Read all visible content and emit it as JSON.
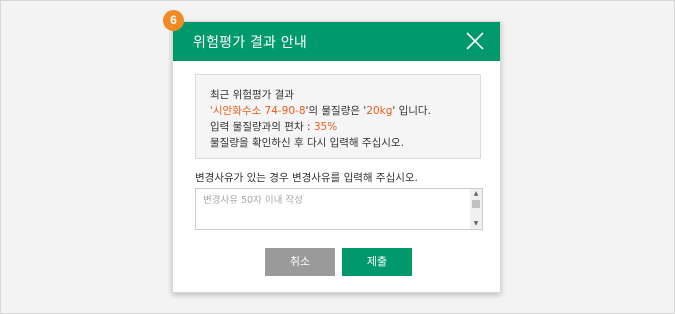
{
  "badge": {
    "number": "6",
    "color": "#f08a24"
  },
  "dialog": {
    "title": "위험평가 결과 안내",
    "close_icon": "close-x-icon",
    "header_color": "#00996b"
  },
  "info": {
    "line1": "최근 위험평가 결과",
    "line2_quote_open": "'",
    "line2_material": "시안화수소 74-90-8",
    "line2_mid": "'의 물질량은 '",
    "line2_amount": "20kg",
    "line2_end": "' 입니다.",
    "line3_prefix": "입력 물질량과의 편차 : ",
    "line3_value": "35%",
    "line4": "물질량을 확인하신 후 다시 입력해 주십시오.",
    "highlight_color": "#e95d1c"
  },
  "reason": {
    "label": "변경사유가 있는 경우 변경사유를 입력해 주십시오.",
    "placeholder": "변경사유 50자 이내 작성",
    "value": ""
  },
  "buttons": {
    "cancel_label": "취소",
    "submit_label": "제출"
  }
}
